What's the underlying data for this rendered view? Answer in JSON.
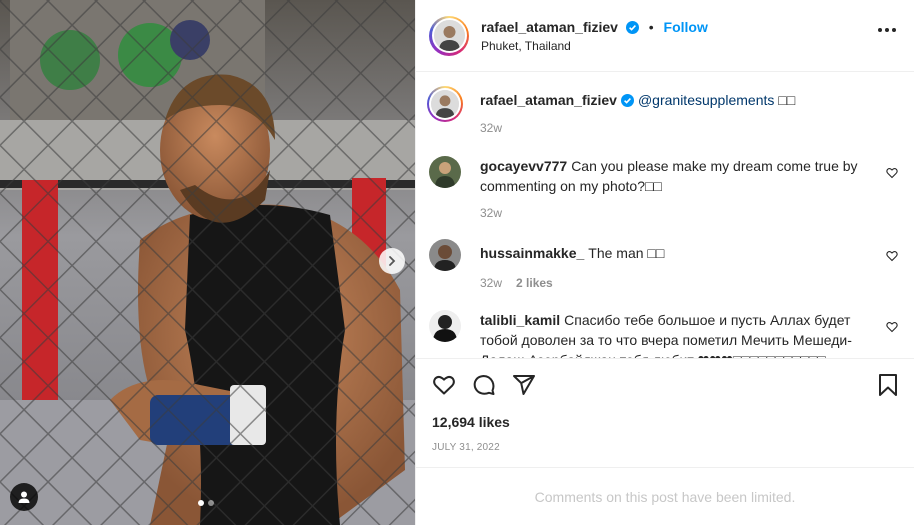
{
  "header": {
    "username": "rafael_ataman_fiziev",
    "separator": "•",
    "follow_label": "Follow",
    "location": "Phuket, Thailand",
    "more_icon": "more-horizontal-icon"
  },
  "caption": {
    "username": "rafael_ataman_fiziev",
    "mention": "@granitesupplements",
    "emoji": "□□",
    "time": "32w"
  },
  "comments": [
    {
      "username": "gocayevv777",
      "text": "Can you please make my dream come true by commenting on my photo?□□",
      "time": "32w",
      "likes": ""
    },
    {
      "username": "hussainmakke_",
      "text": "The man □□",
      "time": "32w",
      "likes": "2 likes"
    },
    {
      "username": "talibli_kamil",
      "text": "Спасибо тебе большое и пусть Аллах будет тобой доволен за то что вчера пометил Мечить Мешеди-Далаш Азербайджан тебя любит ❤❤❤□□□□□□□□□□□",
      "time": "",
      "likes": ""
    }
  ],
  "actions": {
    "like_icon": "heart-icon",
    "comment_icon": "comment-icon",
    "share_icon": "share-icon",
    "save_icon": "bookmark-icon"
  },
  "likes_count": "12,694 likes",
  "date": "JULY 31, 2022",
  "comments_limited": "Comments on this post have been limited.",
  "colors": {
    "accent": "#0095f6",
    "text": "#262626",
    "muted": "#8e8e8e",
    "verified": "#0095f6"
  },
  "carousel": {
    "total": 2,
    "current": 1
  }
}
